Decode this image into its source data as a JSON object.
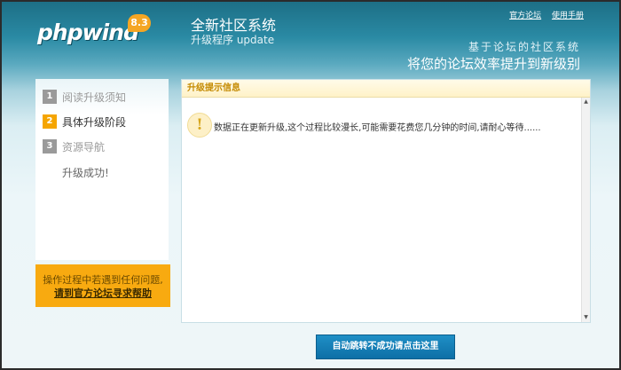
{
  "header": {
    "logo_text": "phpwind",
    "logo_version": "8.3",
    "title": "全新社区系统",
    "subtitle": "升级程序 update",
    "links": [
      "官方论坛",
      "使用手册"
    ],
    "slogan_small": "基于论坛的社区系统",
    "slogan_large": "将您的论坛效率提升到新级别"
  },
  "sidebar": {
    "steps": [
      {
        "num": "1",
        "label": "阅读升级须知"
      },
      {
        "num": "2",
        "label": "具体升级阶段"
      },
      {
        "num": "3",
        "label": "资源导航"
      },
      {
        "num": "",
        "label": "升级成功!"
      }
    ],
    "active_step": 2,
    "help": {
      "text": "操作过程中若遇到任何问题,",
      "link": "请到官方论坛寻求帮助"
    }
  },
  "panel": {
    "title": "升级提示信息",
    "message": "数据正在更新升级,这个过程比较漫长,可能需要花费您几分钟的时间,请耐心等待......"
  },
  "redirect_button": "自动跳转不成功请点击这里",
  "colors": {
    "accent": "#f5a500",
    "header_bg": "#1d6f86",
    "button_bg": "#1f8fc6"
  }
}
